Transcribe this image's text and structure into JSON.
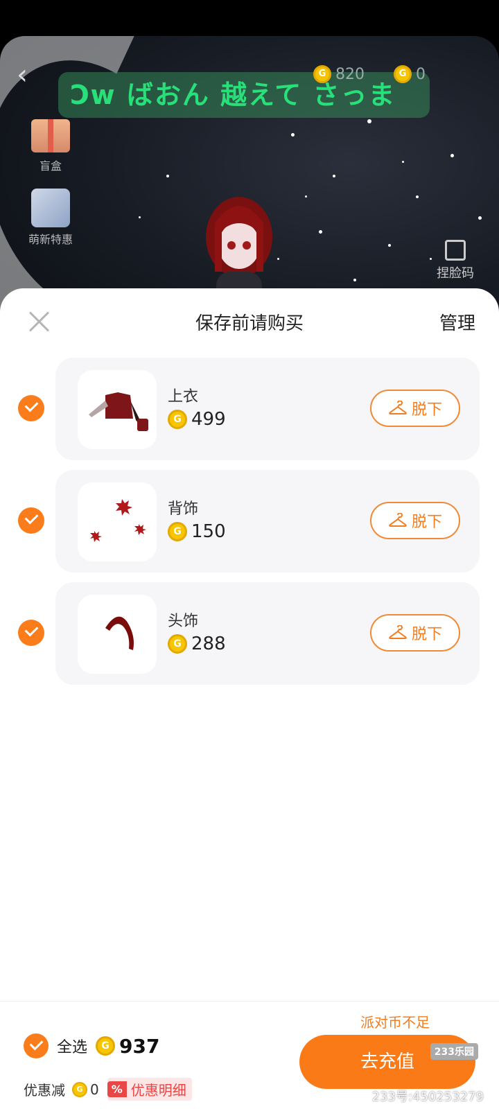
{
  "scene": {
    "nickname": "Ͻw ばおん 越えて さっま",
    "coins_a": "820",
    "coins_b": "0",
    "side_item_1": "盲盒",
    "side_item_2": "萌新特惠",
    "pinch_face": "捏脸码"
  },
  "sheet": {
    "title": "保存前请购买",
    "manage_label": "管理",
    "items": [
      {
        "name": "上衣",
        "price": "499",
        "action": "脱下"
      },
      {
        "name": "背饰",
        "price": "150",
        "action": "脱下"
      },
      {
        "name": "头饰",
        "price": "288",
        "action": "脱下"
      }
    ]
  },
  "footer": {
    "insufficient_text": "派对币不足",
    "select_all_label": "全选",
    "total": "937",
    "discount_label": "优惠减",
    "discount_value": "0",
    "discount_detail": "优惠明细",
    "discount_badge": "%",
    "recharge_label": "去充值",
    "watermark": "233号:450253279",
    "logo": "233乐园"
  },
  "colors": {
    "accent": "#fb7c1b",
    "coin": "#f7c600",
    "discount": "#e94646"
  }
}
